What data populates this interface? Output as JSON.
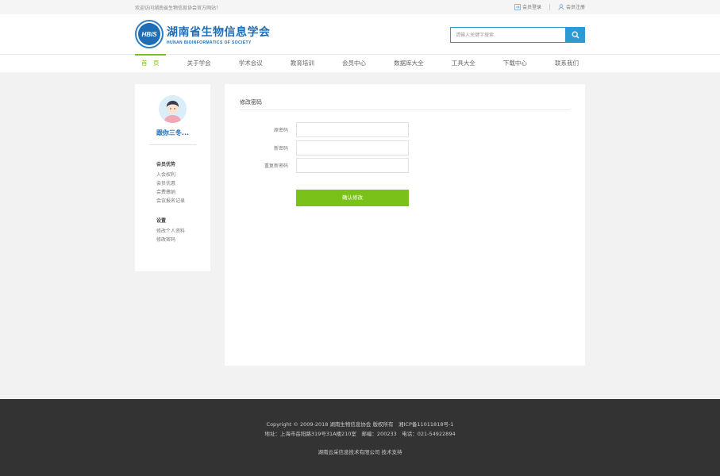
{
  "topbar": {
    "welcome": "欢迎访问湖南省生物信息协会官方网站！",
    "login": "会员登录",
    "register": "会员注册"
  },
  "logo": {
    "badge": "HBIS",
    "name_cn": "湖南省生物信息学会",
    "name_en": "HUNAN BIOINFORMATICS OF SOCIETY"
  },
  "search": {
    "placeholder": "请输入关键字搜索",
    "icon": "search-icon"
  },
  "nav": {
    "items": [
      "首　页",
      "关于学会",
      "学术会议",
      "教育培训",
      "会员中心",
      "数据库大全",
      "工具大全",
      "下载中心",
      "联系我们"
    ],
    "active_index": 0
  },
  "sidebar": {
    "username": "跟你三冬...",
    "groups": [
      {
        "title": "会员优势",
        "items": [
          "入会权利",
          "会员优惠",
          "会费缴纳",
          "会议报名记录"
        ]
      },
      {
        "title": "设置",
        "items": [
          "修改个人资料",
          "修改密码"
        ]
      }
    ]
  },
  "main": {
    "title": "修改密码",
    "fields": [
      {
        "label": "原密码",
        "value": ""
      },
      {
        "label": "新密码",
        "value": ""
      },
      {
        "label": "重复新密码",
        "value": ""
      }
    ],
    "submit": "确认修改"
  },
  "footer": {
    "line1": "Copyright © 2009-2018 湖南生物信息协会 版权所有　湘ICP备11011818号-1",
    "line2": "地址：上海市岳阳路319号31A楼210室　邮编：200233　电话：021-54922894",
    "line3": "湖南云采信息技术有限公司 技术支持"
  },
  "colors": {
    "primary_blue": "#1e6db5",
    "search_blue": "#2e9ad4",
    "accent_green": "#7ac219",
    "footer_bg": "#333333"
  }
}
